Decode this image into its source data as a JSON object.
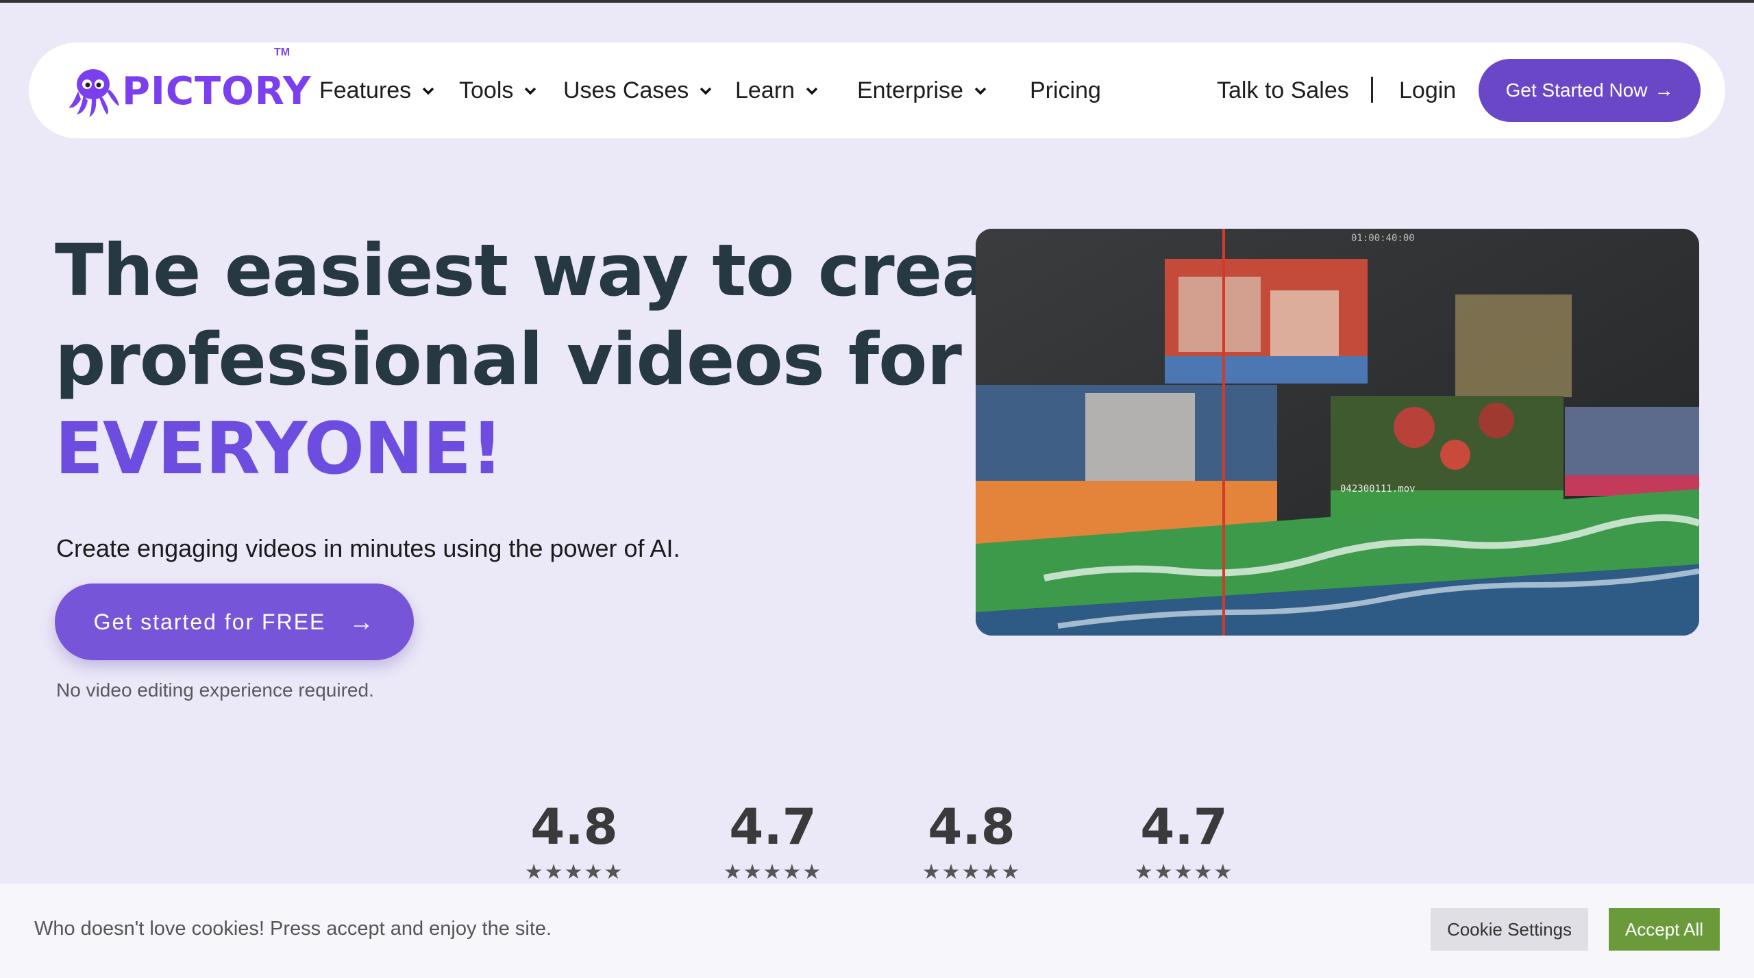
{
  "brand": {
    "name": "PICTORY",
    "tm": "TM"
  },
  "nav": {
    "items": [
      {
        "label": "Features",
        "dropdown": true
      },
      {
        "label": "Tools",
        "dropdown": true
      },
      {
        "label": "Uses Cases",
        "dropdown": true
      },
      {
        "label": "Learn",
        "dropdown": true
      },
      {
        "label": "Enterprise",
        "dropdown": true
      },
      {
        "label": "Pricing",
        "dropdown": false
      }
    ],
    "talk_to_sales": "Talk to Sales",
    "login": "Login",
    "cta": "Get Started Now",
    "cta_arrow": "→"
  },
  "hero": {
    "title_line1": "The easiest way to create",
    "title_line2": "professional videos for",
    "title_accent": "EVERYONE!",
    "subtitle": "Create engaging videos in minutes using the power of AI.",
    "cta": "Get started for FREE",
    "cta_arrow": "→",
    "note": "No video editing experience required."
  },
  "video": {
    "clip_label": "042300111.mov",
    "timecode": "01:00:40:00"
  },
  "ratings": [
    {
      "value": "4.8",
      "stars": "★★★★★"
    },
    {
      "value": "4.7",
      "stars": "★★★★★"
    },
    {
      "value": "4.8",
      "stars": "★★★★★"
    },
    {
      "value": "4.7",
      "stars": "★★★★★"
    }
  ],
  "cookie": {
    "text": "Who doesn't love cookies! Press accept and enjoy the site.",
    "settings": "Cookie Settings",
    "accept": "Accept All"
  },
  "colors": {
    "page_bg": "#ebe8f8",
    "brand_purple": "#7b3ff0",
    "cta_purple": "#6a47c6",
    "accent_text": "#6d4de0",
    "accept_green": "#6a9a3a"
  }
}
